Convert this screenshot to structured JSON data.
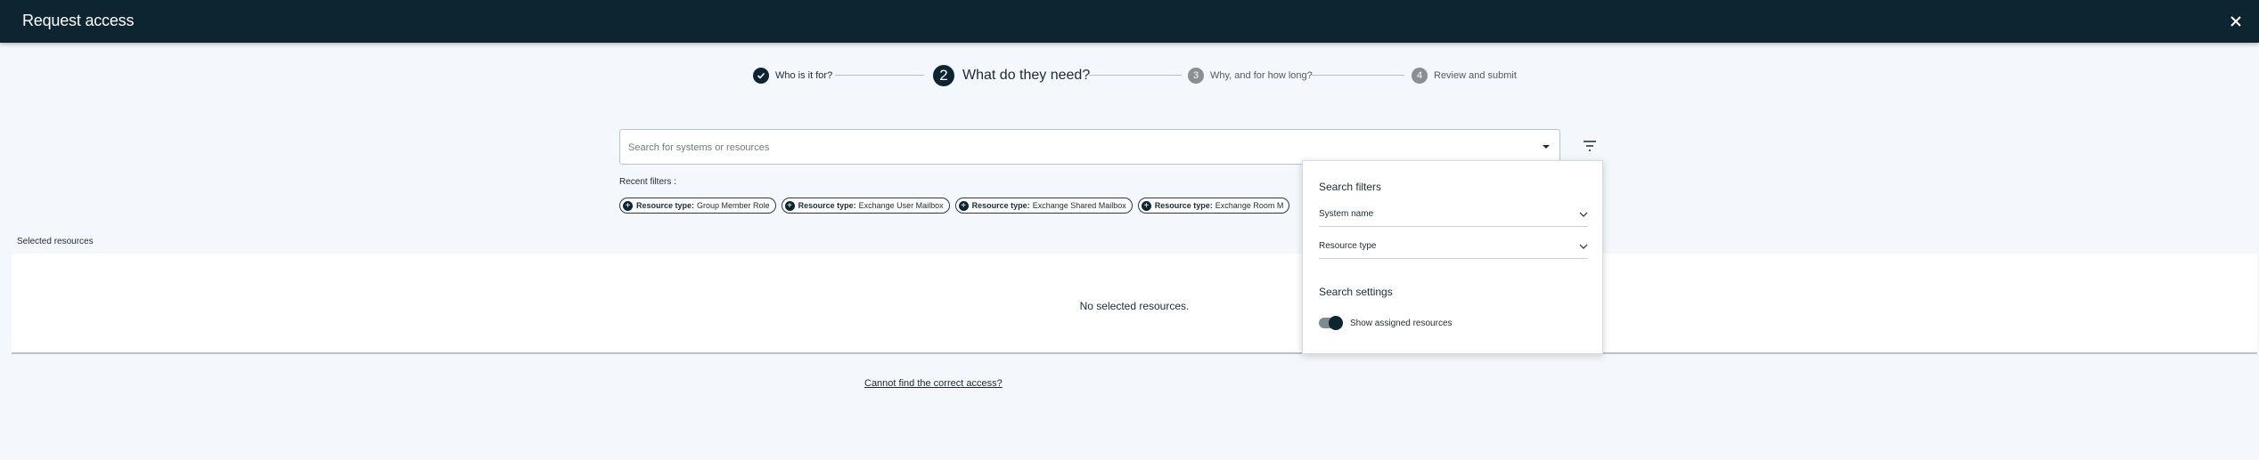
{
  "window": {
    "title": "Request access",
    "close_icon": "close-icon"
  },
  "stepper": {
    "steps": [
      {
        "number": "",
        "label": "Who is it for?",
        "state": "done"
      },
      {
        "number": "2",
        "label": "What do they need?",
        "state": "active"
      },
      {
        "number": "3",
        "label": "Why, and for how long?",
        "state": "todo"
      },
      {
        "number": "4",
        "label": "Review and submit",
        "state": "todo"
      }
    ]
  },
  "search": {
    "placeholder": "Search for systems or resources",
    "value": ""
  },
  "recent_filters": {
    "label": "Recent filters :",
    "chips": [
      {
        "key": "Resource type:",
        "value": "Group Member Role"
      },
      {
        "key": "Resource type:",
        "value": "Exchange User Mailbox"
      },
      {
        "key": "Resource type:",
        "value": "Exchange Shared Mailbox"
      },
      {
        "key": "Resource type:",
        "value": "Exchange Room M"
      }
    ]
  },
  "selected_resources": {
    "label": "Selected resources",
    "empty_text": "No selected resources."
  },
  "footer": {
    "link": "Cannot find the correct access?"
  },
  "filter_popup": {
    "search_filters_title": "Search filters",
    "system_name": "System name",
    "resource_type": "Resource type",
    "search_settings_title": "Search settings",
    "show_assigned_label": "Show assigned resources",
    "show_assigned_on": true
  },
  "colors": {
    "header_bg": "#0d2431",
    "page_bg": "#f4f8fc",
    "accent": "#0d2431"
  }
}
